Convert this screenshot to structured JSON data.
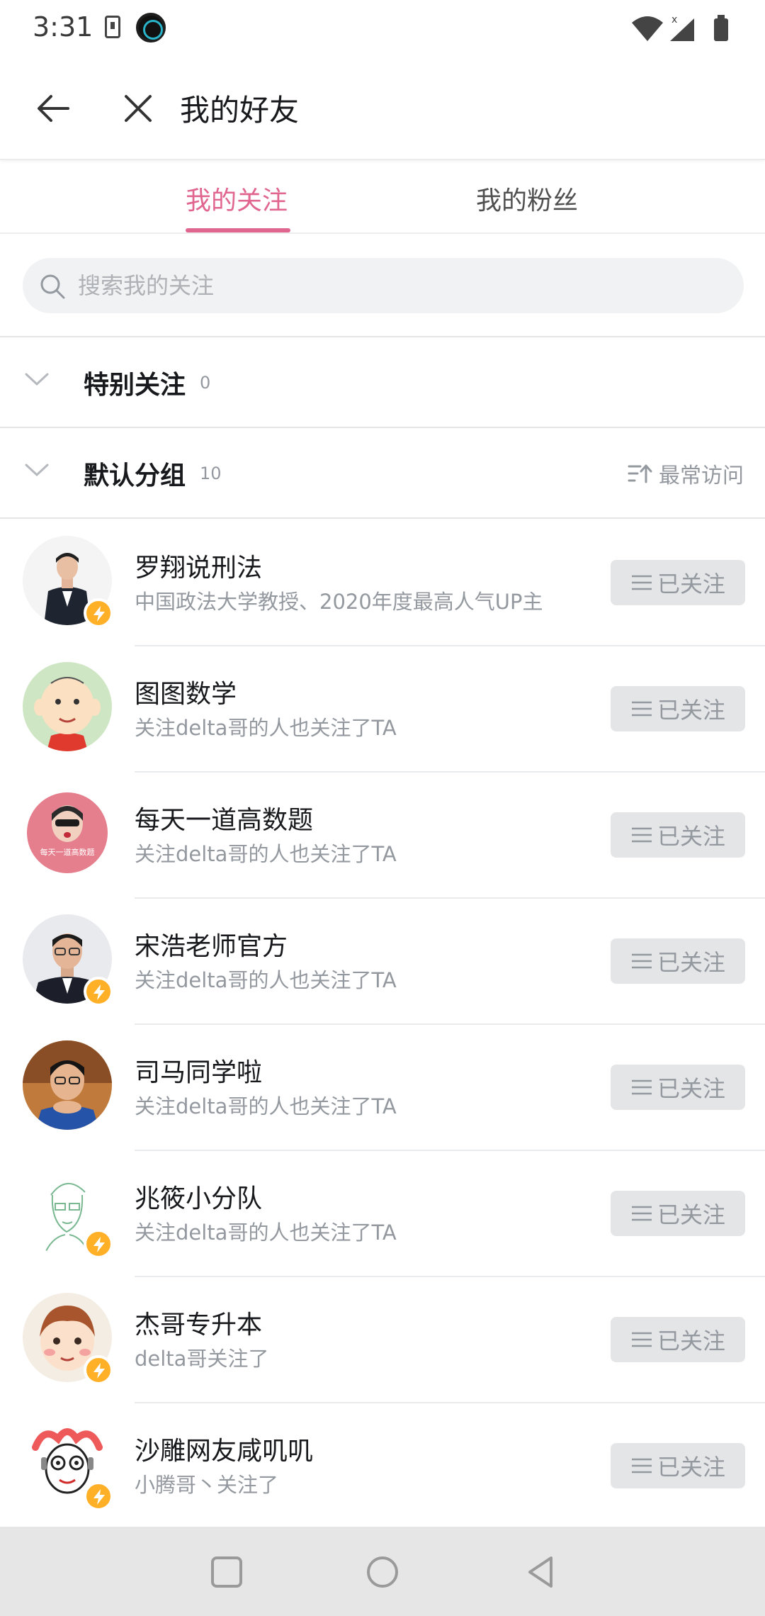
{
  "status_bar": {
    "time": "3:31"
  },
  "header": {
    "title": "我的好友"
  },
  "tabs": [
    {
      "label": "我的关注",
      "active": true
    },
    {
      "label": "我的粉丝",
      "active": false
    }
  ],
  "search": {
    "placeholder": "搜索我的关注"
  },
  "groups": [
    {
      "name": "特别关注",
      "count": "0"
    },
    {
      "name": "默认分组",
      "count": "10",
      "sort_label": "最常访问"
    }
  ],
  "follow_label": "已关注",
  "users": [
    {
      "name": "罗翔说刑法",
      "desc": "中国政法大学教授、2020年度最高人气UP主",
      "verified": true,
      "avatar": "man-in-suit"
    },
    {
      "name": "图图数学",
      "desc": "关注delta哥的人也关注了TA",
      "verified": false,
      "avatar": "cartoon-boy"
    },
    {
      "name": "每天一道高数题",
      "desc": "关注delta哥的人也关注了TA",
      "verified": false,
      "avatar": "pink-round",
      "avatar_text": "每天一道高数题"
    },
    {
      "name": "宋浩老师官方",
      "desc": "关注delta哥的人也关注了TA",
      "verified": true,
      "avatar": "man-glasses"
    },
    {
      "name": "司马同学啦",
      "desc": "关注delta哥的人也关注了TA",
      "verified": false,
      "avatar": "young-man"
    },
    {
      "name": "兆筱小分队",
      "desc": "关注delta哥的人也关注了TA",
      "verified": true,
      "avatar": "sketch-man"
    },
    {
      "name": "杰哥专升本",
      "desc": "delta哥关注了",
      "verified": true,
      "avatar": "cartoon-face"
    },
    {
      "name": "沙雕网友咸叽叽",
      "desc": "小腾哥丶关注了",
      "verified": true,
      "avatar": "cartoon-girl"
    }
  ],
  "colors": {
    "accent": "#e0668f",
    "badge": "#ffb027",
    "muted": "#9499a0"
  }
}
